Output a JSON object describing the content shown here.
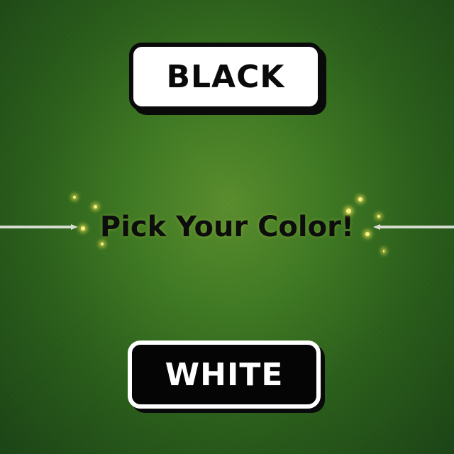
{
  "screen": {
    "title": "Pick Your Color!",
    "options": {
      "black_label": "BLACK",
      "white_label": "WHITE"
    }
  },
  "colors": {
    "background": "#3f7a22",
    "button_black_face": "#ffffff",
    "button_white_face": "#050505",
    "rule": "#d6dcd0",
    "sparkle": "#f5f08a"
  }
}
